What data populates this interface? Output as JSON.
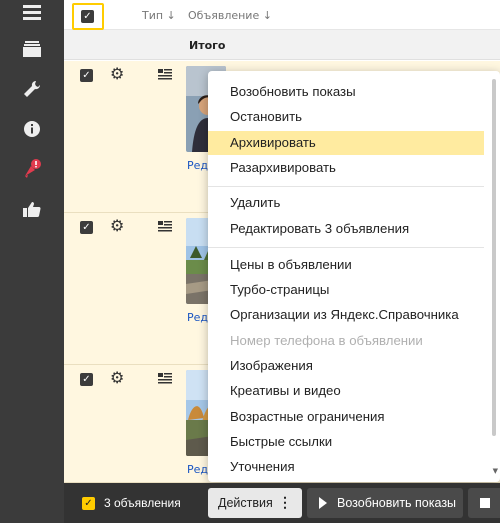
{
  "header": {
    "col_type": "Тип ↓",
    "col_ad": "Объявление ↓",
    "totals_label": "Итого"
  },
  "rows": [
    {
      "edit_link": "Ред"
    },
    {
      "edit_link": "Ред"
    },
    {
      "edit_link": "Ред"
    }
  ],
  "menu": {
    "items": [
      {
        "label": "Возобновить показы"
      },
      {
        "label": "Остановить"
      },
      {
        "label": "Архивировать",
        "state": "highlighted"
      },
      {
        "label": "Разархивировать"
      },
      {
        "label": "Удалить"
      },
      {
        "label": "Редактировать 3 объявления"
      },
      {
        "label": "Цены в объявлении"
      },
      {
        "label": "Турбо-страницы"
      },
      {
        "label": "Организации из Яндекс.Справочника"
      },
      {
        "label": "Номер телефона в объявлении",
        "state": "disabled"
      },
      {
        "label": "Изображения"
      },
      {
        "label": "Креативы и видео"
      },
      {
        "label": "Возрастные ограничения"
      },
      {
        "label": "Быстрые ссылки"
      },
      {
        "label": "Уточнения"
      }
    ]
  },
  "bottom_bar": {
    "selected_count": "3 объявления",
    "actions_label": "Действия",
    "resume_label": "Возобновить показы"
  },
  "colors": {
    "accent_yellow": "#ffcc00",
    "highlight": "#ffeba0",
    "row_bg": "#fff7e0",
    "sidebar": "#3b3b3b",
    "link": "#1a55c2"
  },
  "icons": {
    "sidebar": [
      "menu-icon",
      "layers-icon",
      "wrench-icon",
      "info-icon",
      "rocket-notification-icon",
      "thumbs-up-icon"
    ]
  }
}
